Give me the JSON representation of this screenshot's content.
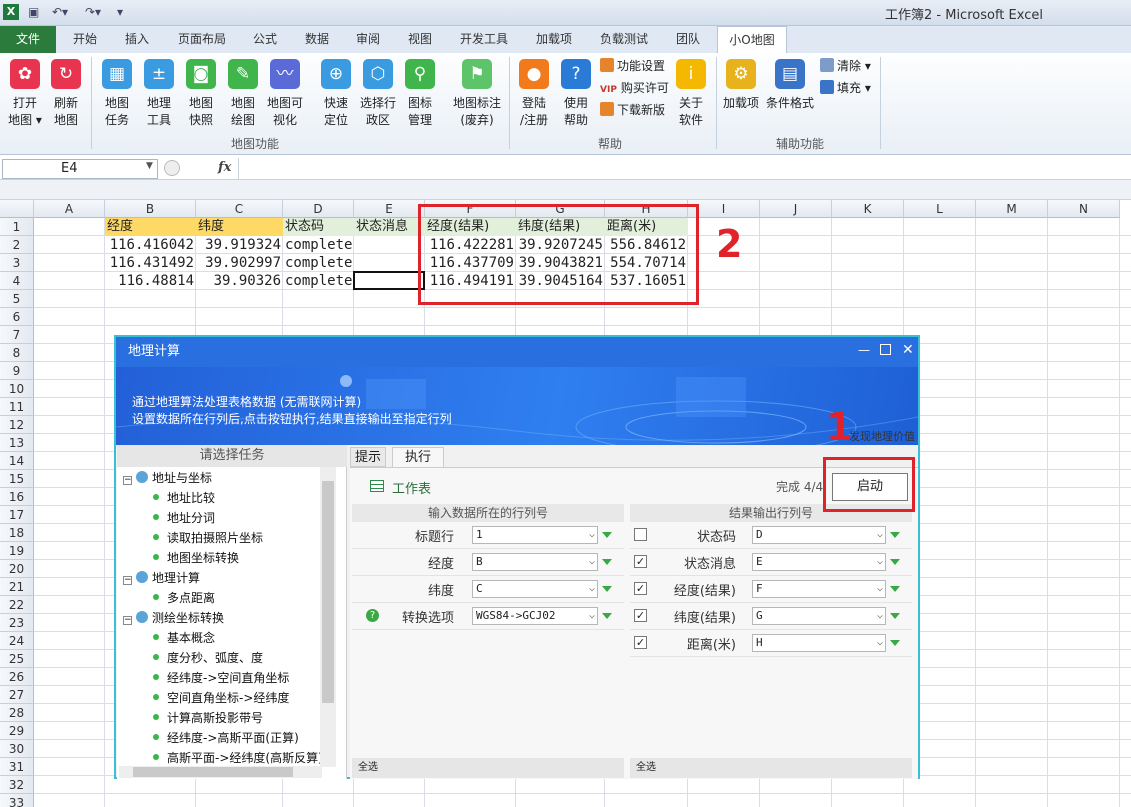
{
  "window": {
    "title": "工作簿2 - Microsoft Excel",
    "app_icon": "X",
    "quick_access_icons": [
      "save-icon",
      "undo-icon",
      "redo-icon",
      "customize-icon"
    ]
  },
  "ribbon_tabs": [
    "文件",
    "开始",
    "插入",
    "页面布局",
    "公式",
    "数据",
    "审阅",
    "视图",
    "开发工具",
    "加载项",
    "负载测试",
    "团队",
    "小O地图"
  ],
  "ribbon": {
    "groups": {
      "map": "地图功能",
      "help": "帮助",
      "aux": "辅助功能"
    },
    "buttons": [
      {
        "label": "打开\n地图",
        "icon": "flower-icon",
        "color": "#e8344f"
      },
      {
        "label": "刷新\n地图",
        "icon": "refresh-icon",
        "color": "#e8344f"
      },
      {
        "label": "地图\n任务",
        "icon": "calendar-icon",
        "color": "#3a9be0"
      },
      {
        "label": "地理\n工具",
        "icon": "calculator-icon",
        "color": "#3a9be0"
      },
      {
        "label": "地图\n快照",
        "icon": "camera-icon",
        "color": "#3fb54c"
      },
      {
        "label": "地图\n绘图",
        "icon": "pencil-icon",
        "color": "#3fb54c"
      },
      {
        "label": "地图可\n视化",
        "icon": "chart-icon",
        "color": "#5a6bd8"
      },
      {
        "label": "快速\n定位",
        "icon": "crosshair-icon",
        "color": "#3a9be0"
      },
      {
        "label": "选择行\n政区",
        "icon": "region-icon",
        "color": "#3a9be0"
      },
      {
        "label": "图标\n管理",
        "icon": "map-pin-icon",
        "color": "#3fb54c"
      },
      {
        "label": "地图标注\n(废弃)",
        "icon": "flag-icon",
        "color": "#5ec46a"
      },
      {
        "label": "登陆\n/注册",
        "icon": "user-icon",
        "color": "#f07a1c"
      },
      {
        "label": "使用\n帮助",
        "icon": "help-icon",
        "color": "#2a7bd6"
      },
      {
        "label": "关于\n软件",
        "icon": "info-icon",
        "color": "#f5b800"
      },
      {
        "label": "加载项",
        "icon": "gears-icon",
        "color": "#e7b21c"
      },
      {
        "label": "条件格式",
        "icon": "table-icon",
        "color": "#3a74c9"
      }
    ],
    "small_buttons": [
      {
        "label": "功能设置",
        "icon": "settings-icon"
      },
      {
        "label": "购买许可",
        "icon": "vip-icon"
      },
      {
        "label": "下载新版",
        "icon": "download-icon"
      },
      {
        "label": "清除 ▾",
        "icon": "eraser-icon"
      },
      {
        "label": "填充 ▾",
        "icon": "fill-icon"
      }
    ],
    "vip_text": "VIP"
  },
  "formula_bar": {
    "name_box": "E4",
    "fx": "fx",
    "value": ""
  },
  "sheet": {
    "columns": [
      "A",
      "B",
      "C",
      "D",
      "E",
      "F",
      "G",
      "H",
      "I",
      "J",
      "K",
      "L",
      "M",
      "N"
    ],
    "rows": [
      "1",
      "2",
      "3",
      "4",
      "5",
      "6",
      "7",
      "8",
      "9",
      "10",
      "11",
      "12",
      "13",
      "14",
      "15",
      "16",
      "17",
      "18",
      "19",
      "20",
      "21",
      "22",
      "23",
      "24",
      "25",
      "26",
      "27",
      "28",
      "29",
      "30",
      "31",
      "32",
      "33"
    ],
    "header_row": [
      "经度",
      "纬度",
      "状态码",
      "状态消息",
      "经度(结果)",
      "纬度(结果)",
      "距离(米)"
    ],
    "data": [
      [
        "116.416042",
        "39.919324",
        "complete",
        "",
        "116.422281",
        "39.9207245",
        "556.84612"
      ],
      [
        "116.431492",
        "39.902997",
        "complete",
        "",
        "116.437709",
        "39.9043821",
        "554.70714"
      ],
      [
        "116.48814",
        "39.90326",
        "complete",
        "",
        "116.494191",
        "39.9045164",
        "537.16051"
      ]
    ],
    "header_fill": "#ffd966",
    "result_fill": "#e2efda"
  },
  "annotations": {
    "step1": "1",
    "step2": "2",
    "color": "#e0232a"
  },
  "dialog": {
    "title": "地理计算",
    "banner_line1": "通过地理算法处理表格数据 (无需联网计算)",
    "banner_line2": "设置数据所在行列后,点击按钮执行,结果直接输出至指定行列",
    "find_value": "发现地理价值",
    "tree_header": "请选择任务",
    "tree": [
      {
        "label": "地址与坐标",
        "level": 0
      },
      {
        "label": "地址比较",
        "level": 1
      },
      {
        "label": "地址分词",
        "level": 1
      },
      {
        "label": "读取拍摄照片坐标",
        "level": 1
      },
      {
        "label": "地图坐标转换",
        "level": 1
      },
      {
        "label": "地理计算",
        "level": 0
      },
      {
        "label": "多点距离",
        "level": 1
      },
      {
        "label": "测绘坐标转换",
        "level": 0
      },
      {
        "label": "基本概念",
        "level": 1
      },
      {
        "label": "度分秒、弧度、度",
        "level": 1
      },
      {
        "label": "经纬度->空间直角坐标",
        "level": 1
      },
      {
        "label": "空间直角坐标->经纬度",
        "level": 1
      },
      {
        "label": "计算高斯投影带号",
        "level": 1
      },
      {
        "label": "经纬度->高斯平面(正算)",
        "level": 1
      },
      {
        "label": "高斯平面->经纬度(高斯反算)",
        "level": 1
      }
    ],
    "tabs": [
      "提示",
      "执行"
    ],
    "worksheet_label": "工作表",
    "progress": "完成 4/4",
    "start_button": "启动",
    "input_header": "输入数据所在的行列号",
    "output_header": "结果输出行列号",
    "inputs": [
      {
        "label": "标题行",
        "value": "1"
      },
      {
        "label": "经度",
        "value": "B"
      },
      {
        "label": "纬度",
        "value": "C"
      },
      {
        "label": "转换选项",
        "value": "WGS84->GCJ02"
      }
    ],
    "outputs": [
      {
        "label": "状态码",
        "value": "D",
        "checked": false
      },
      {
        "label": "状态消息",
        "value": "E",
        "checked": true
      },
      {
        "label": "经度(结果)",
        "value": "F",
        "checked": true
      },
      {
        "label": "纬度(结果)",
        "value": "G",
        "checked": true
      },
      {
        "label": "距离(米)",
        "value": "H",
        "checked": true
      }
    ],
    "select_all": "全选",
    "check_mark": "✓"
  }
}
